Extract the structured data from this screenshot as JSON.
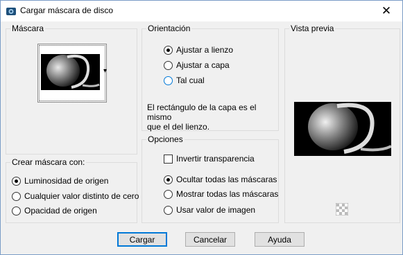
{
  "window": {
    "title": "Cargar máscara de disco",
    "close_glyph": "✕"
  },
  "mask_group": {
    "label": "Máscara",
    "dropdown_arrow": "▾"
  },
  "create_group": {
    "label": "Crear máscara con:",
    "options": [
      {
        "label": "Luminosidad de origen",
        "checked": true
      },
      {
        "label": "Cualquier valor distinto de cero",
        "checked": false
      },
      {
        "label": "Opacidad de origen",
        "checked": false
      }
    ]
  },
  "orientation_group": {
    "label": "Orientación",
    "options": [
      {
        "label": "Ajustar a lienzo",
        "checked": true
      },
      {
        "label": "Ajustar a capa",
        "checked": false
      },
      {
        "label": "Tal cual",
        "checked": false
      }
    ],
    "info_line1": "El rectángulo de la capa es el mismo",
    "info_line2": "que el del lienzo."
  },
  "options_group": {
    "label": "Opciones",
    "invert_label": "Invertir transparencia",
    "invert_checked": false,
    "radios": [
      {
        "label": "Ocultar todas las máscaras",
        "checked": true
      },
      {
        "label": "Mostrar todas las máscaras",
        "checked": false
      },
      {
        "label": "Usar valor de imagen",
        "checked": false
      }
    ]
  },
  "preview_group": {
    "label": "Vista previa"
  },
  "buttons": {
    "load": "Cargar",
    "cancel": "Cancelar",
    "help": "Ayuda"
  },
  "colors": {
    "accent": "#0078d7",
    "panel": "#f0f0f0"
  }
}
